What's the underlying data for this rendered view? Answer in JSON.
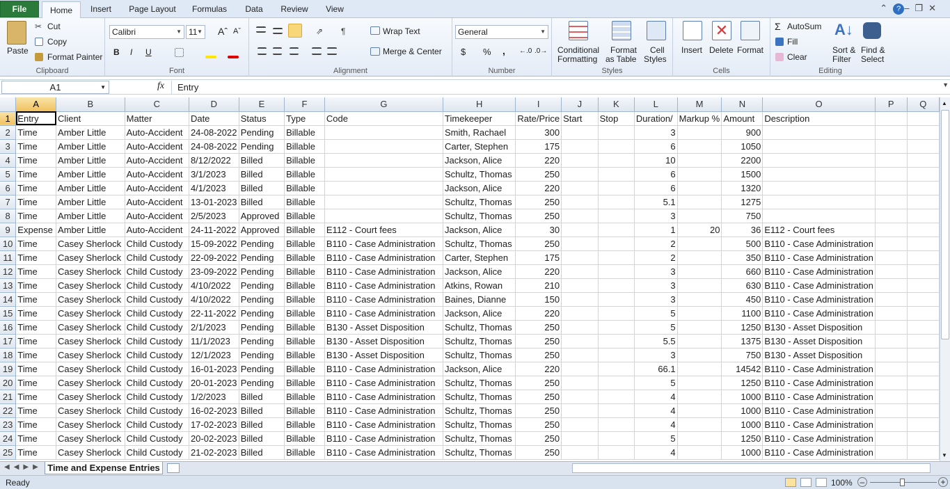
{
  "ribbon_tabs": [
    "File",
    "Home",
    "Insert",
    "Page Layout",
    "Formulas",
    "Data",
    "Review",
    "View"
  ],
  "clipboard": {
    "paste": "Paste",
    "cut": "Cut",
    "copy": "Copy",
    "format_painter": "Format Painter",
    "label": "Clipboard"
  },
  "font": {
    "name": "Calibri",
    "size": "11",
    "label": "Font",
    "bold": "B",
    "italic": "I",
    "underline": "U"
  },
  "alignment": {
    "wrap_text": "Wrap Text",
    "merge_center": "Merge & Center",
    "label": "Alignment"
  },
  "number": {
    "format": "General",
    "currency": "$",
    "percent": "%",
    "comma": ",",
    "label": "Number"
  },
  "styles": {
    "conditional": "Conditional",
    "conditional2": "Formatting",
    "format_table": "Format",
    "format_table2": "as Table",
    "cell_styles": "Cell",
    "cell_styles2": "Styles",
    "label": "Styles"
  },
  "cells": {
    "insert": "Insert",
    "delete": "Delete",
    "format": "Format",
    "label": "Cells"
  },
  "editing": {
    "autosum": "AutoSum",
    "fill": "Fill",
    "clear": "Clear",
    "sort": "Sort &",
    "sort2": "Filter",
    "find": "Find &",
    "find2": "Select",
    "label": "Editing"
  },
  "formula_bar": {
    "name_box": "A1",
    "fx": "fx",
    "content": "Entry"
  },
  "columns": [
    "A",
    "B",
    "C",
    "D",
    "E",
    "F",
    "G",
    "H",
    "I",
    "J",
    "K",
    "L",
    "M",
    "N",
    "O",
    "P",
    "Q"
  ],
  "rows": [
    [
      "Entry",
      "Client",
      "Matter",
      "Date",
      "Status",
      "Type",
      "Code",
      "Timekeeper",
      "Rate/Price",
      "Start",
      "Stop",
      "Duration/",
      "Markup %",
      "Amount",
      "Description",
      "",
      ""
    ],
    [
      "Time",
      "Amber Little",
      "Auto-Accident",
      "24-08-2022",
      "Pending",
      "Billable",
      "",
      "Smith, Rachael",
      "300",
      "",
      "",
      "3",
      "",
      "900",
      "",
      "",
      ""
    ],
    [
      "Time",
      "Amber Little",
      "Auto-Accident",
      "24-08-2022",
      "Pending",
      "Billable",
      "",
      "Carter, Stephen",
      "175",
      "",
      "",
      "6",
      "",
      "1050",
      "",
      "",
      ""
    ],
    [
      "Time",
      "Amber Little",
      "Auto-Accident",
      "8/12/2022",
      "Billed",
      "Billable",
      "",
      "Jackson, Alice",
      "220",
      "",
      "",
      "10",
      "",
      "2200",
      "",
      "",
      ""
    ],
    [
      "Time",
      "Amber Little",
      "Auto-Accident",
      "3/1/2023",
      "Billed",
      "Billable",
      "",
      "Schultz, Thomas",
      "250",
      "",
      "",
      "6",
      "",
      "1500",
      "",
      "",
      ""
    ],
    [
      "Time",
      "Amber Little",
      "Auto-Accident",
      "4/1/2023",
      "Billed",
      "Billable",
      "",
      "Jackson, Alice",
      "220",
      "",
      "",
      "6",
      "",
      "1320",
      "",
      "",
      ""
    ],
    [
      "Time",
      "Amber Little",
      "Auto-Accident",
      "13-01-2023",
      "Billed",
      "Billable",
      "",
      "Schultz, Thomas",
      "250",
      "",
      "",
      "5.1",
      "",
      "1275",
      "",
      "",
      ""
    ],
    [
      "Time",
      "Amber Little",
      "Auto-Accident",
      "2/5/2023",
      "Approved",
      "Billable",
      "",
      "Schultz, Thomas",
      "250",
      "",
      "",
      "3",
      "",
      "750",
      "",
      "",
      ""
    ],
    [
      "Expense",
      "Amber Little",
      "Auto-Accident",
      "24-11-2022",
      "Approved",
      "Billable",
      "E112 - Court fees",
      "Jackson, Alice",
      "30",
      "",
      "",
      "1",
      "20",
      "36",
      "E112 - Court fees",
      "",
      ""
    ],
    [
      "Time",
      "Casey Sherlock",
      "Child Custody",
      "15-09-2022",
      "Pending",
      "Billable",
      "B110 - Case Administration",
      "Schultz, Thomas",
      "250",
      "",
      "",
      "2",
      "",
      "500",
      "B110 - Case Administration",
      "",
      ""
    ],
    [
      "Time",
      "Casey Sherlock",
      "Child Custody",
      "22-09-2022",
      "Pending",
      "Billable",
      "B110 - Case Administration",
      "Carter, Stephen",
      "175",
      "",
      "",
      "2",
      "",
      "350",
      "B110 - Case Administration",
      "",
      ""
    ],
    [
      "Time",
      "Casey Sherlock",
      "Child Custody",
      "23-09-2022",
      "Pending",
      "Billable",
      "B110 - Case Administration",
      "Jackson, Alice",
      "220",
      "",
      "",
      "3",
      "",
      "660",
      "B110 - Case Administration",
      "",
      ""
    ],
    [
      "Time",
      "Casey Sherlock",
      "Child Custody",
      "4/10/2022",
      "Pending",
      "Billable",
      "B110 - Case Administration",
      "Atkins, Rowan",
      "210",
      "",
      "",
      "3",
      "",
      "630",
      "B110 - Case Administration",
      "",
      ""
    ],
    [
      "Time",
      "Casey Sherlock",
      "Child Custody",
      "4/10/2022",
      "Pending",
      "Billable",
      "B110 - Case Administration",
      "Baines, Dianne",
      "150",
      "",
      "",
      "3",
      "",
      "450",
      "B110 - Case Administration",
      "",
      ""
    ],
    [
      "Time",
      "Casey Sherlock",
      "Child Custody",
      "22-11-2022",
      "Pending",
      "Billable",
      "B110 - Case Administration",
      "Jackson, Alice",
      "220",
      "",
      "",
      "5",
      "",
      "1100",
      "B110 - Case Administration",
      "",
      ""
    ],
    [
      "Time",
      "Casey Sherlock",
      "Child Custody",
      "2/1/2023",
      "Pending",
      "Billable",
      "B130 - Asset Disposition",
      "Schultz, Thomas",
      "250",
      "",
      "",
      "5",
      "",
      "1250",
      "B130 - Asset Disposition",
      "",
      ""
    ],
    [
      "Time",
      "Casey Sherlock",
      "Child Custody",
      "11/1/2023",
      "Pending",
      "Billable",
      "B130 - Asset Disposition",
      "Schultz, Thomas",
      "250",
      "",
      "",
      "5.5",
      "",
      "1375",
      "B130 - Asset Disposition",
      "",
      ""
    ],
    [
      "Time",
      "Casey Sherlock",
      "Child Custody",
      "12/1/2023",
      "Pending",
      "Billable",
      "B130 - Asset Disposition",
      "Schultz, Thomas",
      "250",
      "",
      "",
      "3",
      "",
      "750",
      "B130 - Asset Disposition",
      "",
      ""
    ],
    [
      "Time",
      "Casey Sherlock",
      "Child Custody",
      "16-01-2023",
      "Pending",
      "Billable",
      "B110 - Case Administration",
      "Jackson, Alice",
      "220",
      "",
      "",
      "66.1",
      "",
      "14542",
      "B110 - Case Administration",
      "",
      ""
    ],
    [
      "Time",
      "Casey Sherlock",
      "Child Custody",
      "20-01-2023",
      "Pending",
      "Billable",
      "B110 - Case Administration",
      "Schultz, Thomas",
      "250",
      "",
      "",
      "5",
      "",
      "1250",
      "B110 - Case Administration",
      "",
      ""
    ],
    [
      "Time",
      "Casey Sherlock",
      "Child Custody",
      "1/2/2023",
      "Billed",
      "Billable",
      "B110 - Case Administration",
      "Schultz, Thomas",
      "250",
      "",
      "",
      "4",
      "",
      "1000",
      "B110 - Case Administration",
      "",
      ""
    ],
    [
      "Time",
      "Casey Sherlock",
      "Child Custody",
      "16-02-2023",
      "Billed",
      "Billable",
      "B110 - Case Administration",
      "Schultz, Thomas",
      "250",
      "",
      "",
      "4",
      "",
      "1000",
      "B110 - Case Administration",
      "",
      ""
    ],
    [
      "Time",
      "Casey Sherlock",
      "Child Custody",
      "17-02-2023",
      "Billed",
      "Billable",
      "B110 - Case Administration",
      "Schultz, Thomas",
      "250",
      "",
      "",
      "4",
      "",
      "1000",
      "B110 - Case Administration",
      "",
      ""
    ],
    [
      "Time",
      "Casey Sherlock",
      "Child Custody",
      "20-02-2023",
      "Billed",
      "Billable",
      "B110 - Case Administration",
      "Schultz, Thomas",
      "250",
      "",
      "",
      "5",
      "",
      "1250",
      "B110 - Case Administration",
      "",
      ""
    ],
    [
      "Time",
      "Casey Sherlock",
      "Child Custody",
      "21-02-2023",
      "Billed",
      "Billable",
      "B110 - Case Administration",
      "Schultz, Thomas",
      "250",
      "",
      "",
      "4",
      "",
      "1000",
      "B110 - Case Administration",
      "",
      ""
    ]
  ],
  "sheet_tab": "Time and Expense Entries",
  "status": {
    "ready": "Ready",
    "zoom": "100%"
  },
  "colors": {
    "file_tab": "#2a7b3a",
    "selected_header": "#f1c15f",
    "ribbon_bg": "#e4ecf7"
  }
}
